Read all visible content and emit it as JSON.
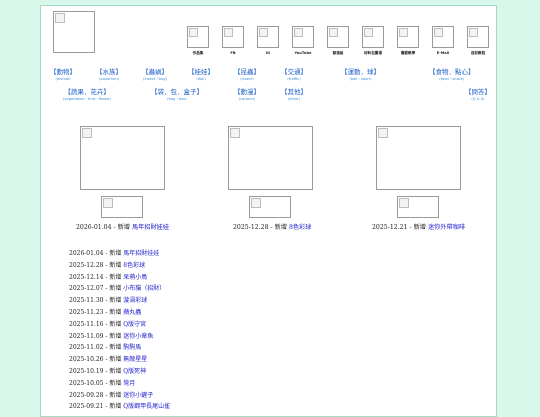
{
  "top_icons": [
    {
      "label": "作品集"
    },
    {
      "label": "FB"
    },
    {
      "label": "IG"
    },
    {
      "label": "YouTube"
    },
    {
      "label": "部落格"
    },
    {
      "label": "材料包賣場"
    },
    {
      "label": "購買教學"
    },
    {
      "label": "E-Mail"
    },
    {
      "label": "目前教程"
    }
  ],
  "categories_row1": [
    {
      "label": "【動物】",
      "sub": "(animal)"
    },
    {
      "label": "【水族】",
      "sub": "(aquarium)"
    },
    {
      "label": "【蟲蝸】",
      "sub": "(insect / bug)"
    },
    {
      "label": "【娃娃】",
      "sub": "(doll)"
    },
    {
      "label": "【昆蟲】",
      "sub": "(insect)"
    },
    {
      "label": "【交通】",
      "sub": "(traffic)"
    },
    {
      "label": "【運動．球】",
      "sub": "(ball・sport)"
    },
    {
      "label": "【食物．點心】",
      "sub": "(food・snack)"
    }
  ],
  "categories_row2": [
    {
      "label": "【蔬果．花卉】",
      "sub": "(vegetables・fruit・flower)"
    },
    {
      "label": "【袋．包．盒子】",
      "sub": "(bag・box)"
    },
    {
      "label": "【動漫】",
      "sub": "(cartoon)"
    },
    {
      "label": "【其他】",
      "sub": "(other)"
    }
  ],
  "qa": {
    "label": "【問答】",
    "sub": "(Q & A)"
  },
  "featured": [
    {
      "date": "2026-01.04",
      "prefix": "新增",
      "name": "馬年招財娃娃"
    },
    {
      "date": "2025-12.28",
      "prefix": "新增",
      "name": "8色彩球"
    },
    {
      "date": "2025-12.21",
      "prefix": "新增",
      "name": "迷你外帶咖啡"
    }
  ],
  "updates": [
    {
      "date": "2026-01.04",
      "prefix": "新增",
      "name": "馬年招財娃娃"
    },
    {
      "date": "2025-12.28",
      "prefix": "新增",
      "name": "8色彩球"
    },
    {
      "date": "2025-12.14",
      "prefix": "新增",
      "name": "呆萌小鳥"
    },
    {
      "date": "2025-12.07",
      "prefix": "新增",
      "name": "小布貓（招財）"
    },
    {
      "date": "2025-11.30",
      "prefix": "新增",
      "name": "漩渦彩球"
    },
    {
      "date": "2025-11.23",
      "prefix": "新增",
      "name": "蘋丸蟲"
    },
    {
      "date": "2025-11.16",
      "prefix": "新增",
      "name": "Q版守宮"
    },
    {
      "date": "2025-11.09",
      "prefix": "新增",
      "name": "迷你小章魚"
    },
    {
      "date": "2025-11.02",
      "prefix": "新增",
      "name": "駒駒馬"
    },
    {
      "date": "2025-10.26",
      "prefix": "新增",
      "name": "無敵星星"
    },
    {
      "date": "2025-10.19",
      "prefix": "新增",
      "name": "Q版死神"
    },
    {
      "date": "2025-10.05",
      "prefix": "新增",
      "name": "彎月"
    },
    {
      "date": "2025-09.28",
      "prefix": "新增",
      "name": "迷你小鏟子"
    },
    {
      "date": "2025-09.21",
      "prefix": "新增",
      "name": "Q版鋼甲長尾山雀"
    }
  ]
}
